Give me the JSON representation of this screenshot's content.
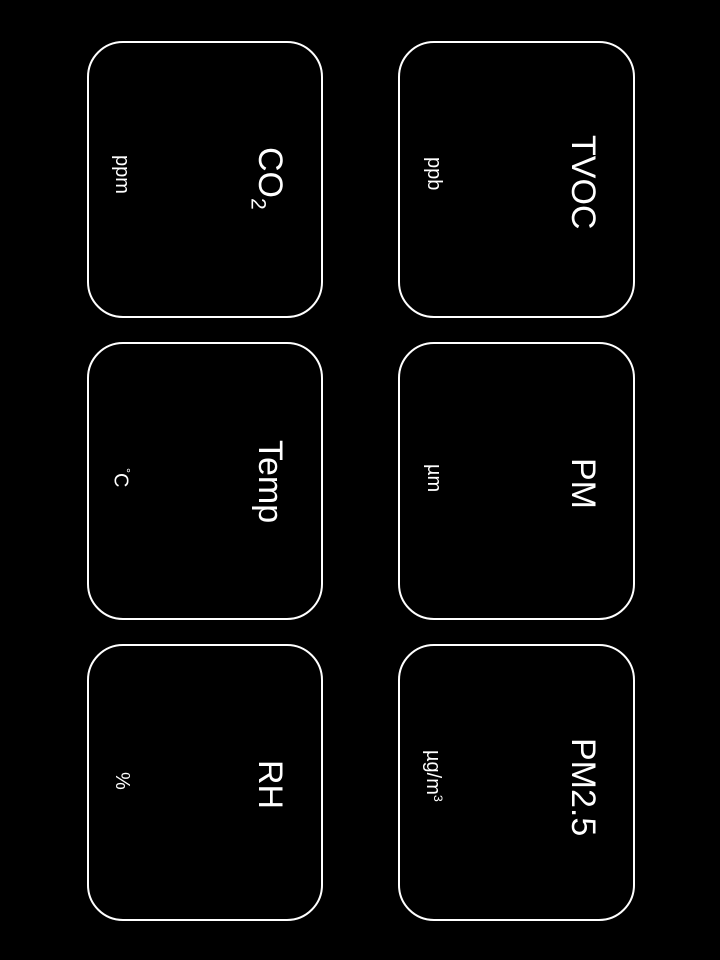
{
  "theme": {
    "background": "#000000",
    "foreground": "#ffffff"
  },
  "tiles": {
    "tvoc": {
      "title": "TVOC",
      "unit": "ppb"
    },
    "pm": {
      "title": "PM",
      "unit": "µm"
    },
    "pm25": {
      "title": "PM2.5",
      "unit_base": "µg/m",
      "unit_sup": "3"
    },
    "co2": {
      "title_base": "CO",
      "title_sub": "2",
      "unit": "ppm"
    },
    "temp": {
      "title": "Temp",
      "unit_sup": "°",
      "unit_base": "C"
    },
    "rh": {
      "title": "RH",
      "unit": "%"
    }
  }
}
